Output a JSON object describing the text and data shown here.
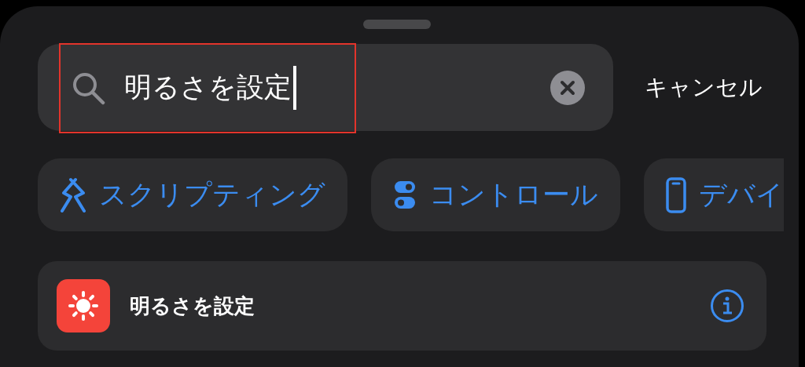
{
  "search": {
    "value": "明るさを設定",
    "highlighted": true,
    "cancel": "キャンセル"
  },
  "categories": [
    {
      "label": "スクリプティング",
      "kind": "scripting"
    },
    {
      "label": "コントロール",
      "kind": "control"
    },
    {
      "label": "デバイ",
      "kind": "device"
    }
  ],
  "results": [
    {
      "title": "明るさを設定",
      "kind": "brightness"
    }
  ]
}
